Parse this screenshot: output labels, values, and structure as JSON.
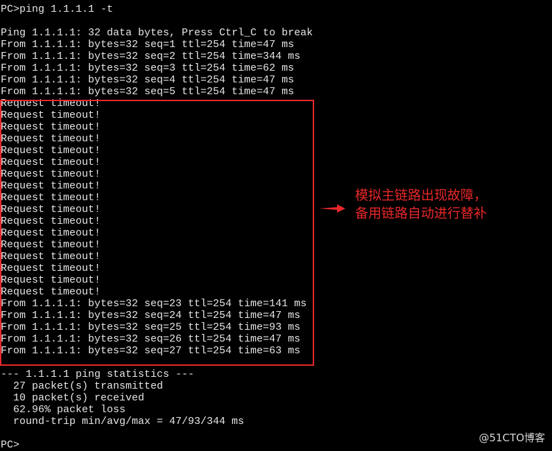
{
  "terminal": {
    "lines": [
      "PC>ping 1.1.1.1 -t",
      "",
      "Ping 1.1.1.1: 32 data bytes, Press Ctrl_C to break",
      "From 1.1.1.1: bytes=32 seq=1 ttl=254 time=47 ms",
      "From 1.1.1.1: bytes=32 seq=2 ttl=254 time=344 ms",
      "From 1.1.1.1: bytes=32 seq=3 ttl=254 time=62 ms",
      "From 1.1.1.1: bytes=32 seq=4 ttl=254 time=47 ms",
      "From 1.1.1.1: bytes=32 seq=5 ttl=254 time=47 ms",
      "Request timeout!",
      "Request timeout!",
      "Request timeout!",
      "Request timeout!",
      "Request timeout!",
      "Request timeout!",
      "Request timeout!",
      "Request timeout!",
      "Request timeout!",
      "Request timeout!",
      "Request timeout!",
      "Request timeout!",
      "Request timeout!",
      "Request timeout!",
      "Request timeout!",
      "Request timeout!",
      "Request timeout!",
      "From 1.1.1.1: bytes=32 seq=23 ttl=254 time=141 ms",
      "From 1.1.1.1: bytes=32 seq=24 ttl=254 time=47 ms",
      "From 1.1.1.1: bytes=32 seq=25 ttl=254 time=93 ms",
      "From 1.1.1.1: bytes=32 seq=26 ttl=254 time=47 ms",
      "From 1.1.1.1: bytes=32 seq=27 ttl=254 time=63 ms",
      "",
      "--- 1.1.1.1 ping statistics ---",
      "  27 packet(s) transmitted",
      "  10 packet(s) received",
      "  62.96% packet loss",
      "  round-trip min/avg/max = 47/93/344 ms",
      "",
      "PC>"
    ]
  },
  "annotation": {
    "line1": "模拟主链路出现故障，",
    "line2": "备用链路自动进行替补",
    "color": "#e8282a"
  },
  "watermark": "@51CTO博客"
}
